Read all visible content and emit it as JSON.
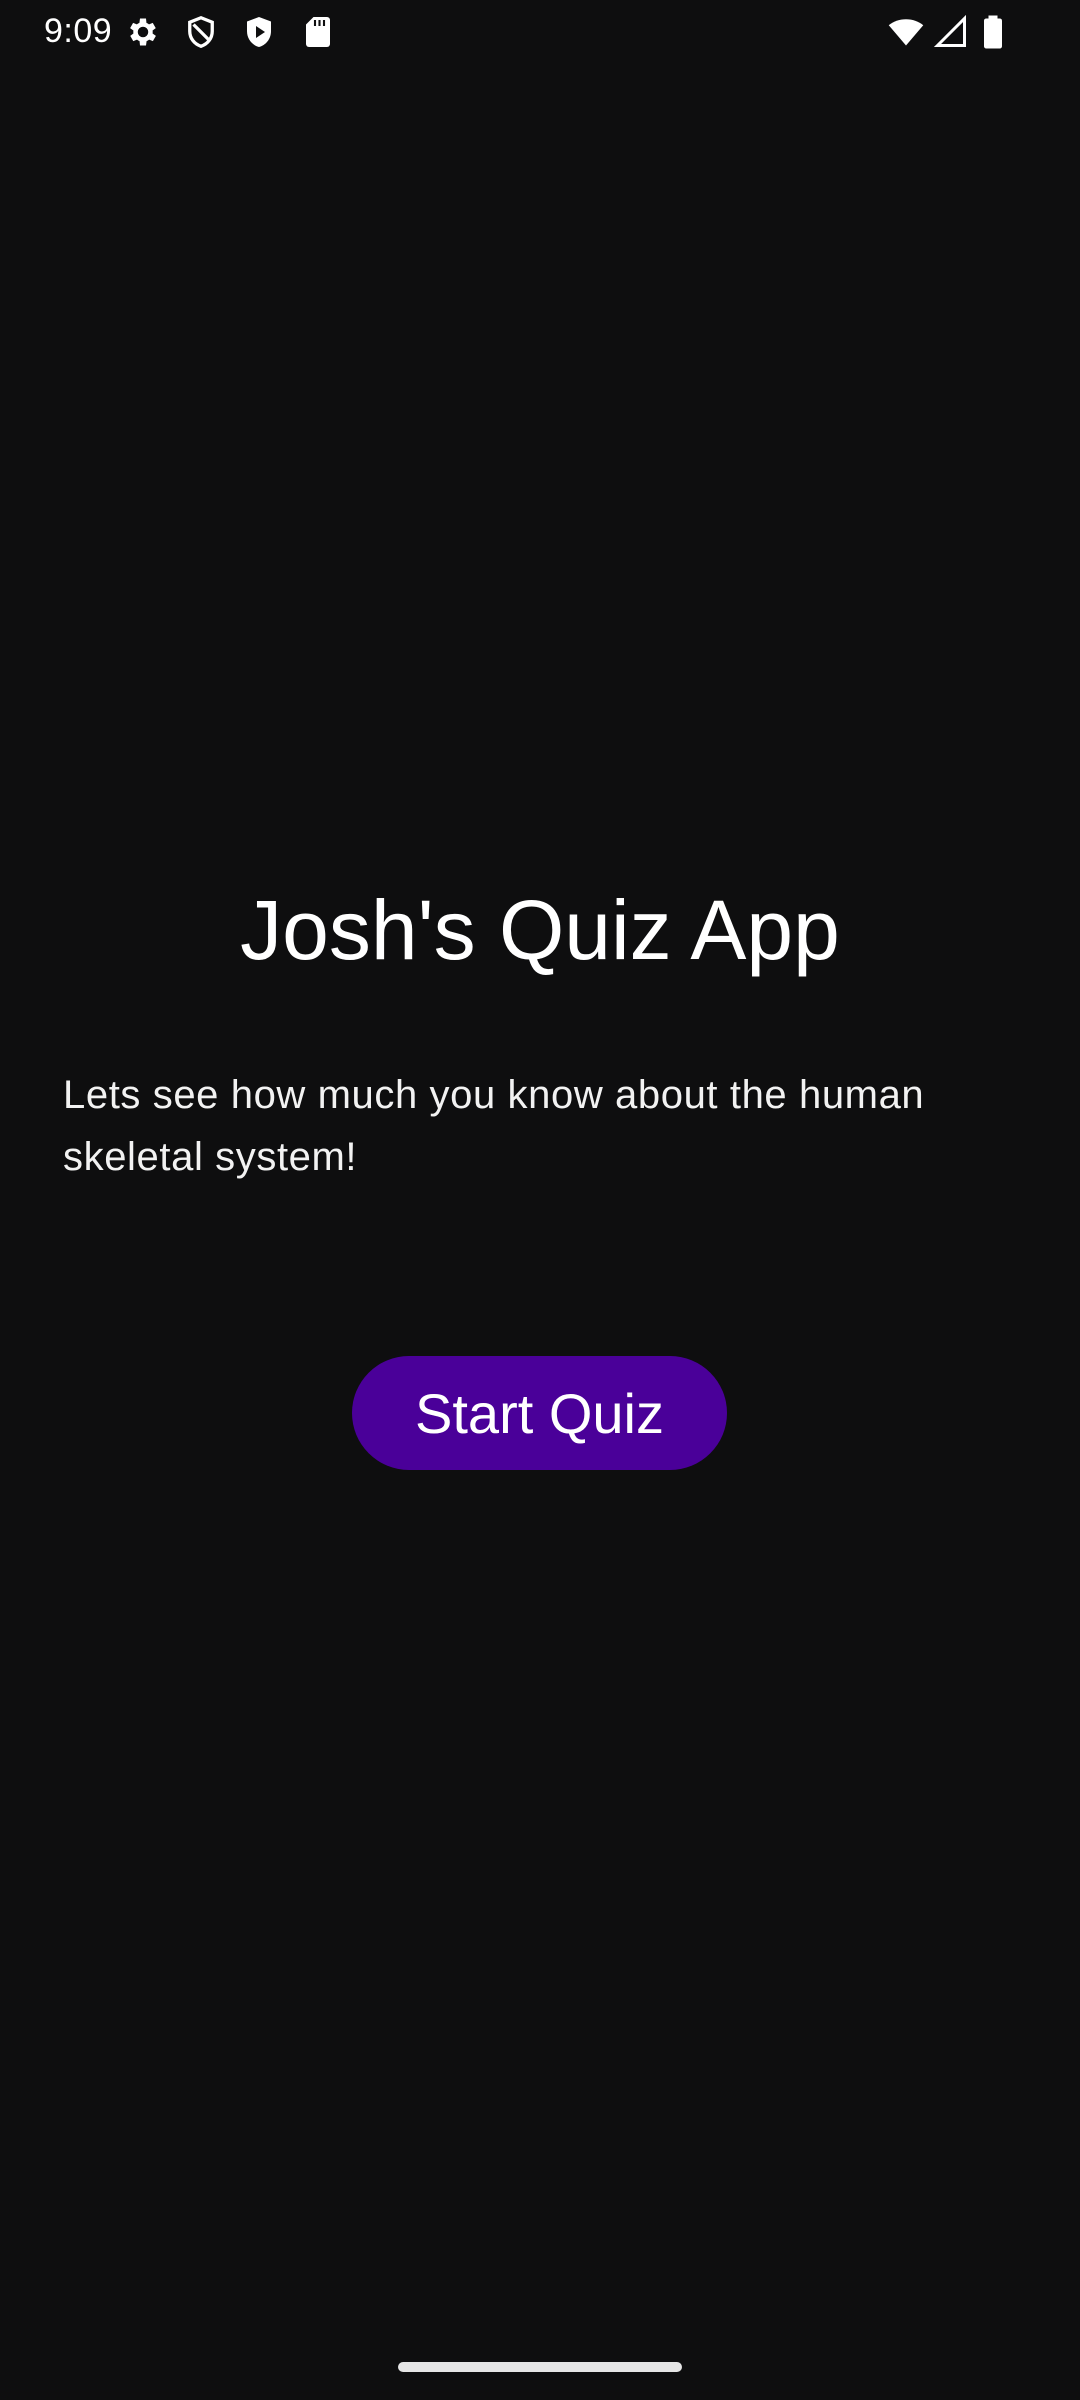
{
  "status_bar": {
    "time": "9:09",
    "icons": [
      "gear-icon",
      "shield-icon",
      "play-shield-icon",
      "sd-card-icon",
      "wifi-icon",
      "cell-signal-icon",
      "battery-icon"
    ]
  },
  "main": {
    "title": "Josh's Quiz App",
    "description": "Lets see how much you know about the human skeletal system!",
    "start_button_label": "Start Quiz"
  },
  "colors": {
    "background": "#0e0e0f",
    "button": "#4a0099",
    "text": "#ffffff"
  }
}
